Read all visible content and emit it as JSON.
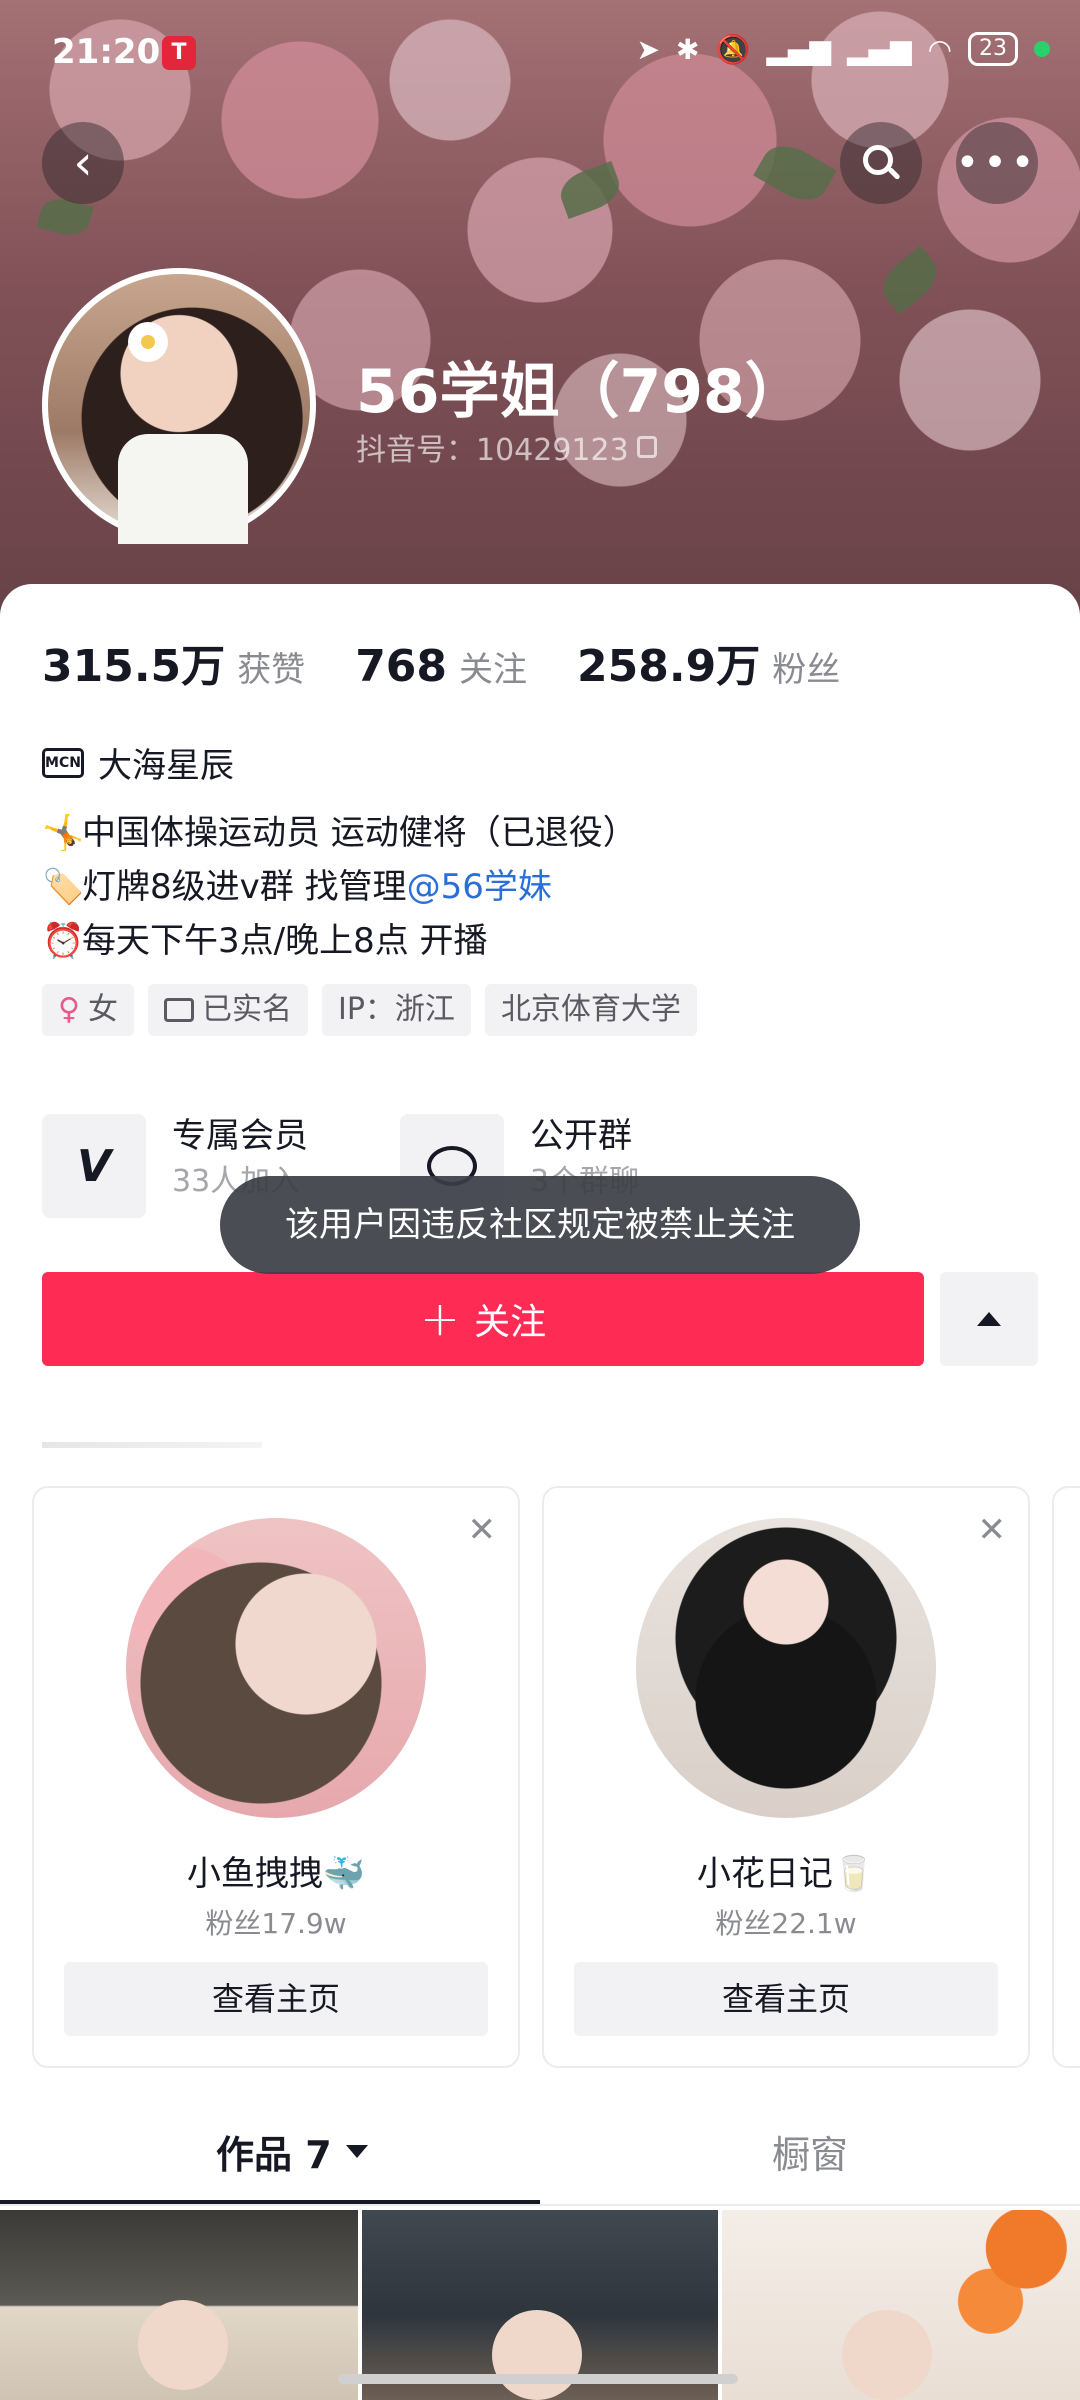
{
  "status_bar": {
    "time": "21:20",
    "battery": "23",
    "icons": [
      "location-icon",
      "bluetooth-icon",
      "mute-icon",
      "signal-hd-icon",
      "signal-hd-icon",
      "wifi-icon"
    ]
  },
  "profile": {
    "name": "56学姐（798）",
    "douyin_id": "抖音号：10429123"
  },
  "stats": [
    {
      "value": "315.5万",
      "label": "获赞"
    },
    {
      "value": "768",
      "label": "关注"
    },
    {
      "value": "258.9万",
      "label": "粉丝"
    }
  ],
  "mcn": {
    "name": "大海星辰"
  },
  "bio": {
    "line1": "中国体操运动员 运动健将（已退役）",
    "line2_prefix": "灯牌8级进v群 找管理",
    "line2_link": "@56学妹",
    "line3": "每天下午3点/晚上8点 开播"
  },
  "tags": {
    "gender": "女",
    "verified": "已实名",
    "ip": "IP：浙江",
    "school": "北京体育大学"
  },
  "features": {
    "member_title": "专属会员",
    "member_sub": "33人加入",
    "group_title": "公开群",
    "group_sub": "3个群聊"
  },
  "toast": "该用户因违反社区规定被禁止关注",
  "follow_button": "关注",
  "recommendations": [
    {
      "name": "小鱼拽拽🐳",
      "fans": "粉丝17.9w",
      "button": "查看主页"
    },
    {
      "name": "小花日记🥛",
      "fans": "粉丝22.1w",
      "button": "查看主页"
    }
  ],
  "tabs": {
    "works": "作品 7",
    "shop": "橱窗"
  },
  "colors": {
    "accent": "#fe2c55",
    "link": "#2a6fd8"
  }
}
